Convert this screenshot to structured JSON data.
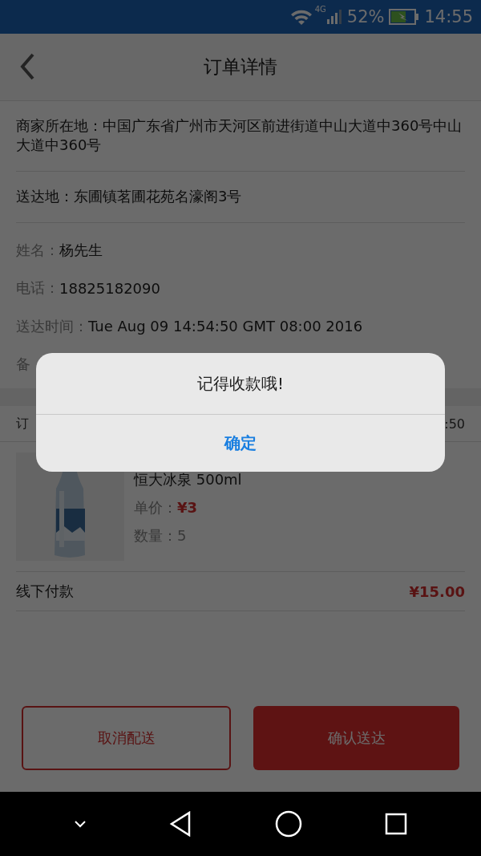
{
  "status_bar": {
    "network": "4G",
    "battery": "52%",
    "time": "14:55"
  },
  "header": {
    "title": "订单详情"
  },
  "address_rows": [
    {
      "text": "商家所在地：中国广东省广州市天河区前进街道中山大道中360号中山大道中360号"
    },
    {
      "text": "送达地：东圃镇茗圃花苑名濠阁3号"
    }
  ],
  "info_rows": [
    {
      "label": "姓名：",
      "value": "杨先生"
    },
    {
      "label": "电话：",
      "value": "18825182090"
    },
    {
      "label": "送达时间：",
      "value": "Tue Aug 09 14:54:50 GMT 08:00 2016"
    },
    {
      "label": "备"
    }
  ],
  "order_bar": {
    "column_1": "订",
    "column_2": ":50"
  },
  "product": {
    "name": "恒大冰泉 500ml",
    "price_label": "单价：",
    "price": "¥3",
    "qty_label": "数量：",
    "qty": "5"
  },
  "payment": {
    "method": "线下付款",
    "total": "¥15.00"
  },
  "buttons": [
    {
      "label": "取消配送",
      "kind": "outline"
    },
    {
      "label": "确认送达",
      "kind": "filled"
    }
  ],
  "dialog": {
    "message": "记得收款哦!",
    "button": "确定"
  }
}
